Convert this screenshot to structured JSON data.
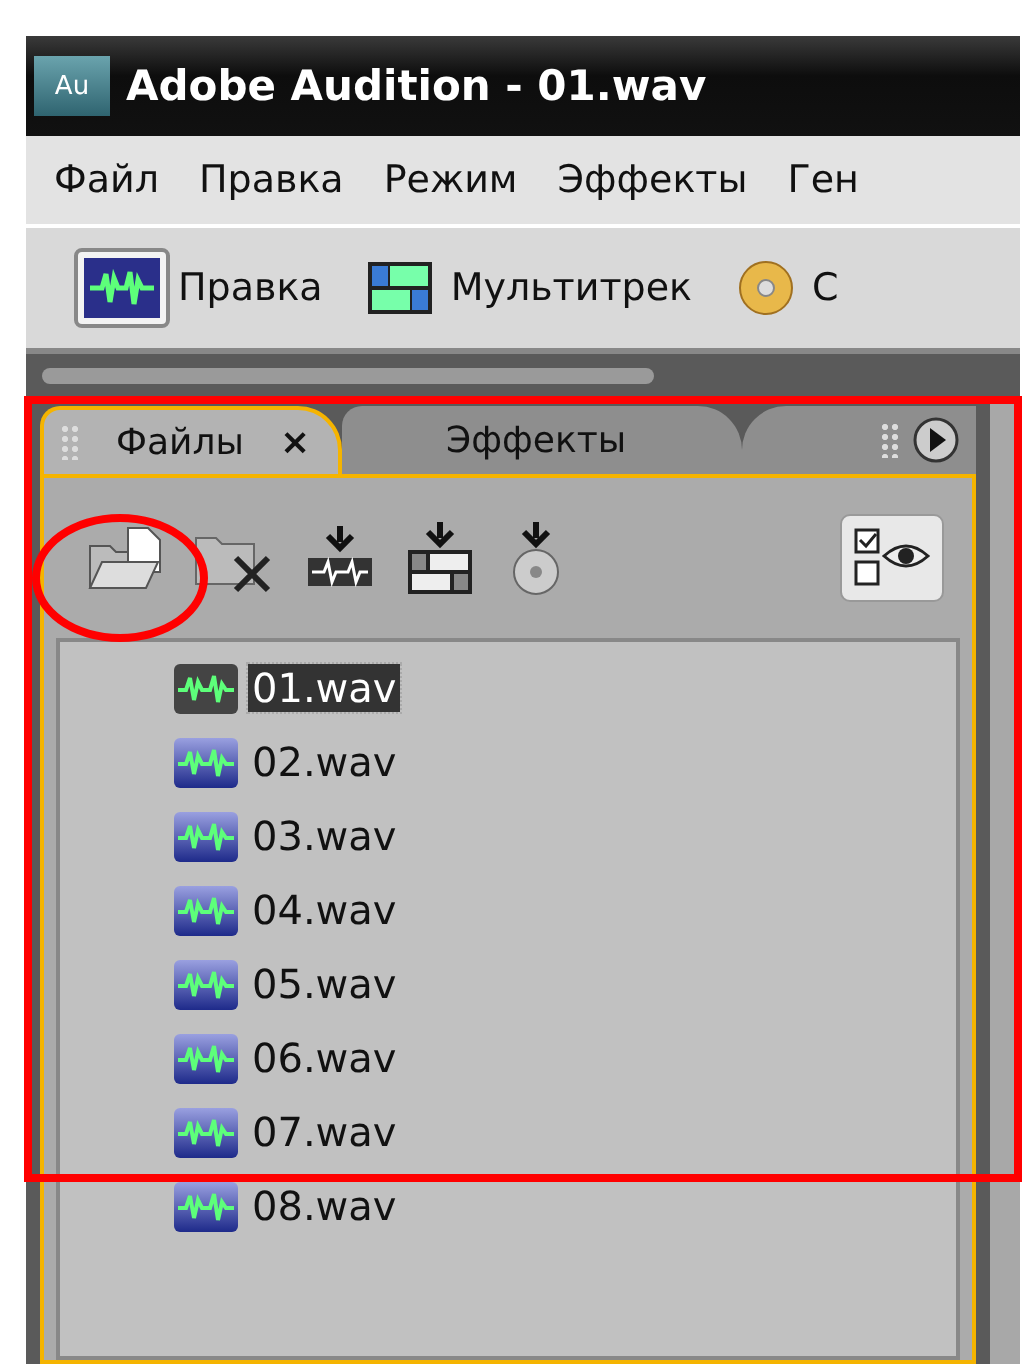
{
  "window": {
    "title": "Adobe Audition - 01.wav",
    "app_badge": "Au"
  },
  "menu": [
    "Файл",
    "Правка",
    "Режим",
    "Эффекты",
    "Ген"
  ],
  "workspace_buttons": [
    {
      "label": "Правка",
      "kind": "waveform",
      "selected": true
    },
    {
      "label": "Мультитрек",
      "kind": "multitrack",
      "selected": false
    },
    {
      "label": "C",
      "kind": "cd",
      "selected": false
    }
  ],
  "panel": {
    "tabs": [
      {
        "label": "Файлы",
        "close": "×",
        "selected": true
      },
      {
        "label": "Эффекты",
        "selected": false
      }
    ],
    "files": [
      {
        "name": "01.wav",
        "selected": true
      },
      {
        "name": "02.wav",
        "selected": false
      },
      {
        "name": "03.wav",
        "selected": false
      },
      {
        "name": "04.wav",
        "selected": false
      },
      {
        "name": "05.wav",
        "selected": false
      },
      {
        "name": "06.wav",
        "selected": false
      },
      {
        "name": "07.wav",
        "selected": false
      },
      {
        "name": "08.wav",
        "selected": false
      }
    ]
  },
  "annotations": [
    {
      "kind": "frame"
    },
    {
      "kind": "circle"
    }
  ]
}
